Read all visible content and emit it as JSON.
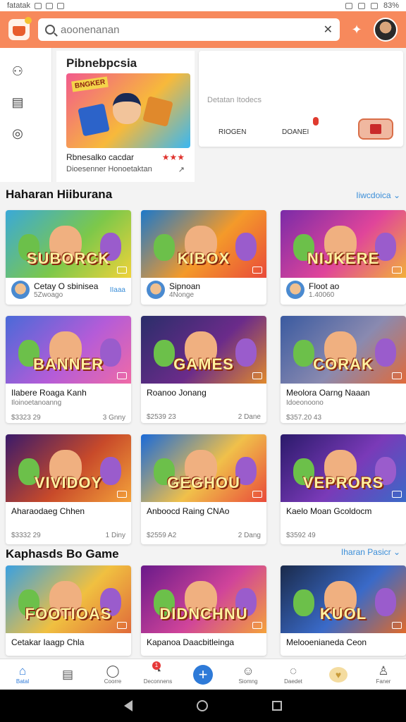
{
  "status": {
    "carrier": "fatatak",
    "battery": "83%"
  },
  "header": {
    "search_placeholder": "aoonenanan",
    "clear": "✕"
  },
  "featured": {
    "heading": "Pibnebpcsia",
    "name": "Rbnesalko cacdar",
    "subtitle": "Dioesenner Honoetaktan",
    "rating_glyph": "★★★",
    "image_tag": "BNGKER"
  },
  "panel": {
    "description": "Detatan Itodecs",
    "btn1": "RIOGEN",
    "btn2": "DOANEI"
  },
  "section1": {
    "title": "Haharan Hiiburana",
    "link": "Iiwcdoica ⌄"
  },
  "section2": {
    "title": "Kaphasds Bo Game",
    "link": "Iharan Pasicr ⌄"
  },
  "cards_row1": [
    {
      "art": "SUBORCK",
      "name": "Cetay O sbinisea",
      "sub": "5Zwoago",
      "link": "IIaaa",
      "bg": "#3aa9d8,#7cc84a,#f0d23a"
    },
    {
      "art": "KIBOX",
      "name": "Sipnoan",
      "sub": "4Nonge",
      "link": "",
      "bg": "#1d78c9,#f49a2a,#e94a3a"
    },
    {
      "art": "NIJKERE",
      "name": "Floot ao",
      "sub": "1.40060",
      "link": "",
      "bg": "#7a2ba8,#e0459a,#f2b03a"
    }
  ],
  "cards_row2": [
    {
      "art": "BANNER",
      "name": "Ilabere Roaga Kanh",
      "sub": "Iloinoetanoanng",
      "price": "$3323 29",
      "tag": "3 Gnny",
      "bg": "#4a6ad8,#b45cd8,#f06aa6"
    },
    {
      "art": "GAMES",
      "name": "Roanoo Jonang",
      "sub": "",
      "price": "$2539 23",
      "tag": "2 Dane",
      "bg": "#2a2e6a,#6b2b8a,#e0892c"
    },
    {
      "art": "CORAK",
      "name": "Meolora Oarng Naaan",
      "sub": "Idoeonoono",
      "price": "$357.20 43",
      "tag": "",
      "bg": "#3a5aa0,#8a8ab0,#e06a3a"
    }
  ],
  "cards_row3": [
    {
      "art": "VIVIDOY",
      "name": "Aharaodaeg Chhen",
      "sub": "",
      "price": "$3332 29",
      "tag": "1 Diny",
      "bg": "#3a1a6a,#c84a2a,#f4a23a"
    },
    {
      "art": "GEGHOU",
      "name": "Anboocd Raing CNAo",
      "sub": "",
      "price": "$2559 A2",
      "tag": "2 Dang",
      "bg": "#1a6ad8,#f0c04a,#e94a3a"
    },
    {
      "art": "VEPRORS",
      "name": "Kaelo Moan Gcoldocm",
      "sub": "",
      "price": "$3592 49",
      "tag": "",
      "bg": "#2a1a6a,#7a3ab8,#3a6ac8"
    }
  ],
  "cards_row4": [
    {
      "art": "FOOTIOAS",
      "name": "Cetakar Iaagp Chla",
      "bg": "#3aa0e0,#f0c040,#e06a3a"
    },
    {
      "art": "DIDNCHNU",
      "name": "Kapanoa Daacbitleinga",
      "bg": "#6a1a8a,#d0449a,#f4a23a"
    },
    {
      "art": "KUOL",
      "name": "Melooenianeda Ceon",
      "bg": "#1a2a4a,#3a6ac8,#e06a2a"
    }
  ],
  "tabs": [
    {
      "label": "Batal",
      "glyph": "⌂",
      "active": true
    },
    {
      "label": "",
      "glyph": "▤",
      "active": false
    },
    {
      "label": "Coorre",
      "glyph": "◯",
      "active": false
    },
    {
      "label": "Deconnens",
      "glyph": "◔",
      "active": false,
      "badge": "1"
    },
    {
      "label": "",
      "glyph": "+",
      "active": false,
      "plus": true
    },
    {
      "label": "Siomng",
      "glyph": "☺",
      "active": false
    },
    {
      "label": "Daedet",
      "glyph": "◌",
      "active": false
    },
    {
      "label": "",
      "glyph": "♥",
      "active": false,
      "heart": true
    },
    {
      "label": "Faner",
      "glyph": "♙",
      "active": false
    }
  ]
}
